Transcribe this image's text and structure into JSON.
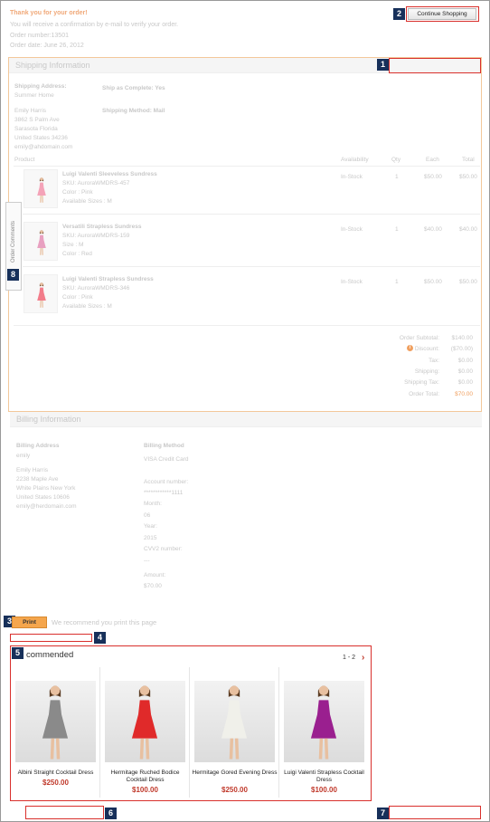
{
  "header": {
    "thanks": "Thank you for your order!",
    "confirmation": "You will receive a confirmation by e-mail to verify your order.",
    "order_number": "Order number:13501",
    "order_date": "Order date: June 26, 2012",
    "continue_button": "Continue Shopping"
  },
  "badges": [
    "1",
    "2",
    "3",
    "4",
    "5",
    "6",
    "7",
    "8"
  ],
  "shipping": {
    "title": "Shipping Information",
    "address_label": "Shipping Address:",
    "address_name": "Summer Home",
    "recipient": "Emily Harris",
    "street": "3862 S Palm Ave",
    "city": "Sarasota Florida",
    "zip": "United States 34236",
    "email": "emily@ahdomain.com",
    "ship_complete": "Ship as Complete: Yes",
    "ship_method": "Shipping Method: Mail"
  },
  "table": {
    "headers": {
      "product": "Product",
      "availability": "Availability",
      "qty": "Qty",
      "each": "Each",
      "total": "Total"
    },
    "rows": [
      {
        "name": "Luigi Valenti Sleeveless Sundress",
        "sku": "SKU: AuroraWMDRS-457",
        "color": "Color : Pink",
        "sizes": "Available Sizes : M",
        "availability": "In-Stock",
        "qty": "1",
        "each": "$50.00",
        "total": "$50.00",
        "dress_color": "#f4a3b8"
      },
      {
        "name": "Versatili Strapless Sundress",
        "sku": "SKU: AuroraWMDRS-159",
        "color": "Size : M",
        "sizes": "Color : Red",
        "availability": "In-Stock",
        "qty": "1",
        "each": "$40.00",
        "total": "$40.00",
        "dress_color": "#e8a0c0"
      },
      {
        "name": "Luigi Valenti Strapless Sundress",
        "sku": "SKU: AuroraWMDRS-346",
        "color": "Color : Pink",
        "sizes": "Available Sizes : M",
        "availability": "In-Stock",
        "qty": "1",
        "each": "$50.00",
        "total": "$50.00",
        "dress_color": "#f27c8a"
      }
    ]
  },
  "totals": [
    {
      "label": "Order Subtotal:",
      "value": "$140.00"
    },
    {
      "label": "Discount:",
      "value": "($70.00)"
    },
    {
      "label": "Tax:",
      "value": "$0.00"
    },
    {
      "label": "Shipping:",
      "value": "$0.00"
    },
    {
      "label": "Shipping Tax:",
      "value": "$0.00"
    },
    {
      "label": "Order Total:",
      "value": "$70.00"
    }
  ],
  "order_comments_tab": "Order Comments",
  "billing": {
    "title": "Billing Information",
    "address_label": "Billing Address",
    "address_name": "emily",
    "recipient": "Emily Harris",
    "street": "2238 Maple Ave",
    "city": "White Plains New York",
    "zip": "United States 10606",
    "email": "emily@herdomain.com",
    "method_label": "Billing Method",
    "method": "VISA Credit Card",
    "account_label": "Account number:",
    "account": "************1111",
    "month_label": "Month:",
    "month": "06",
    "year_label": "Year:",
    "year": "2015",
    "cvv_label": "CVV2 number:",
    "cvv": "---",
    "amount_label": "Amount:",
    "amount": "$70.00"
  },
  "print": {
    "button": "Print",
    "hint": "We recommend you print this page"
  },
  "recommended": {
    "title": "commended",
    "pager": "1 - 2",
    "products": [
      {
        "name": "Albini Straight Cocktail Dress",
        "price": "$250.00",
        "dress_color": "#8a8a8a"
      },
      {
        "name": "Hermitage Ruched Bodice Cocktail Dress",
        "price": "$100.00",
        "dress_color": "#e02a2a"
      },
      {
        "name": "Hermitage Gored Evening Dress",
        "price": "$250.00",
        "dress_color": "#f0f0ea"
      },
      {
        "name": "Luigi Valenti Strapless Cocktail Dress",
        "price": "$100.00",
        "dress_color": "#9a1f8f"
      }
    ]
  }
}
